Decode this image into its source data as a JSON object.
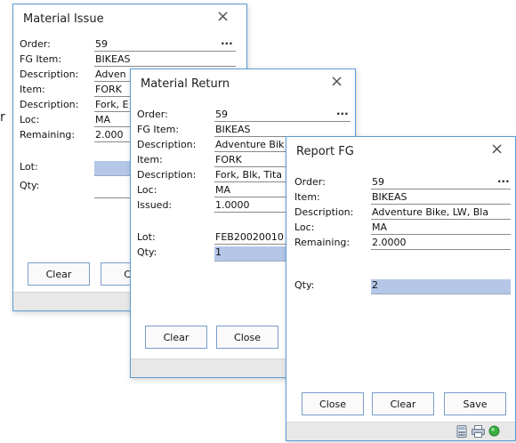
{
  "material_issue": {
    "title": "Material Issue",
    "close": "×",
    "rows": [
      {
        "label": "Order:",
        "value": "59"
      },
      {
        "label": "FG Item:",
        "value": "BIKEAS"
      },
      {
        "label": "Description:",
        "value": "Adven"
      },
      {
        "label": "Item:",
        "value": "FORK"
      },
      {
        "label": "Description:",
        "value": "Fork, E"
      },
      {
        "label": "Loc:",
        "value": "MA"
      },
      {
        "label": "Remaining:",
        "value": "2.000"
      },
      {
        "label": "Lot:",
        "value": ""
      },
      {
        "label": "Qty:",
        "value": ""
      }
    ],
    "ellipsis": "...",
    "buttons": {
      "clear": "Clear",
      "close": "Clo"
    }
  },
  "material_return": {
    "title": "Material Return",
    "close": "×",
    "rows": [
      {
        "label": "Order:",
        "value": "59"
      },
      {
        "label": "FG Item:",
        "value": "BIKEAS"
      },
      {
        "label": "Description:",
        "value": "Adventure Bik"
      },
      {
        "label": "Item:",
        "value": "FORK"
      },
      {
        "label": "Description:",
        "value": "Fork, Blk, Tita"
      },
      {
        "label": "Loc:",
        "value": "MA"
      },
      {
        "label": "Issued:",
        "value": "1.0000"
      },
      {
        "label": "Lot:",
        "value": "FEB20020010"
      },
      {
        "label": "Qty:",
        "value": "1"
      }
    ],
    "ellipsis": "...",
    "buttons": {
      "clear": "Clear",
      "close": "Close"
    }
  },
  "report_fg": {
    "title": "Report FG",
    "close": "×",
    "rows": [
      {
        "label": "Order:",
        "value": "59"
      },
      {
        "label": "Item:",
        "value": "BIKEAS"
      },
      {
        "label": "Description:",
        "value": "Adventure Bike, LW, Bla"
      },
      {
        "label": "Loc:",
        "value": "MA"
      },
      {
        "label": "Remaining:",
        "value": "2.0000"
      },
      {
        "label": "Qty:",
        "value": "2"
      }
    ],
    "ellipsis": "...",
    "buttons": {
      "close": "Close",
      "clear": "Clear",
      "save": "Save"
    }
  },
  "stray_text": "r",
  "colors": {
    "accent_border": "#5b9bd5",
    "highlight_field": "#b4c7e7",
    "status_bar": "#e8e8e8"
  },
  "icons": [
    "calculator-icon",
    "printer-icon",
    "status-green-icon"
  ]
}
